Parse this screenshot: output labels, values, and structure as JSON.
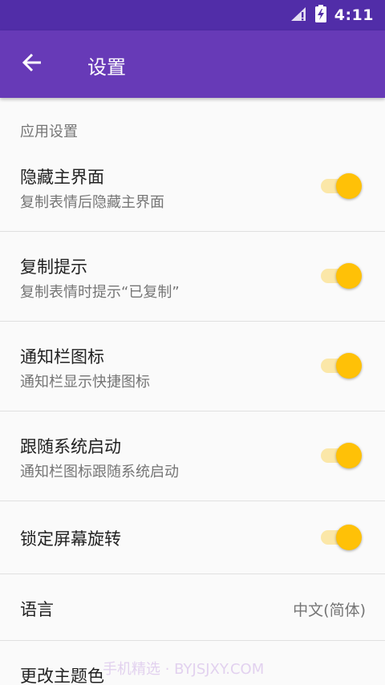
{
  "status_bar": {
    "time": "4:11",
    "icons": [
      "signal-no-data-icon",
      "battery-charging-icon"
    ],
    "color": "#512da8"
  },
  "app_bar": {
    "title": "设置",
    "back_icon": "arrow-back-icon",
    "color": "#673ab7"
  },
  "section": {
    "header": "应用设置"
  },
  "settings": [
    {
      "title": "隐藏主界面",
      "subtitle": "复制表情后隐藏主界面",
      "enabled": true
    },
    {
      "title": "复制提示",
      "subtitle": "复制表情时提示“已复制”",
      "enabled": true
    },
    {
      "title": "通知栏图标",
      "subtitle": "通知栏显示快捷图标",
      "enabled": true
    },
    {
      "title": "跟随系统启动",
      "subtitle": "通知栏图标跟随系统启动",
      "enabled": true
    },
    {
      "title": "锁定屏幕旋转",
      "enabled": true
    },
    {
      "title": "语言",
      "value": "中文(简体)"
    },
    {
      "title": "更改主题色"
    }
  ],
  "watermark": "手机精选 · BYJSJXY.COM",
  "colors": {
    "accent": "#ffc107",
    "accent_track": "#fbe7a8"
  }
}
